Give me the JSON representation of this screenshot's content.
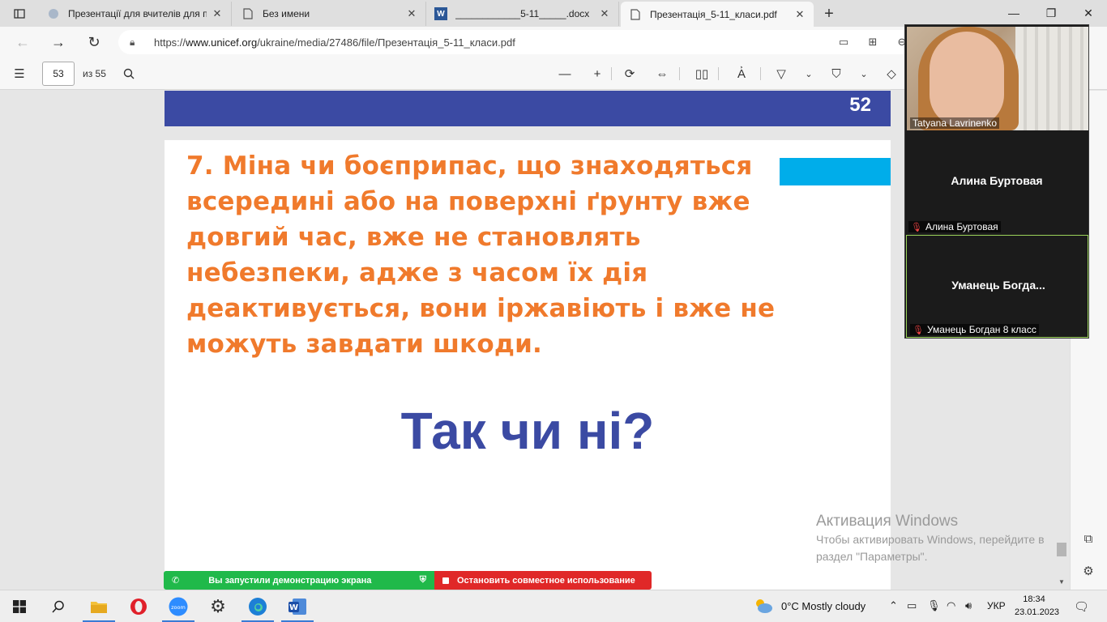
{
  "browser": {
    "tabs": [
      {
        "title": "Презентації для вчителів для про",
        "icon": "globe-icon",
        "active": false
      },
      {
        "title": "Без имени",
        "icon": "page-icon",
        "active": false
      },
      {
        "title": "____________5-11_____.docx",
        "icon": "word-icon",
        "active": false
      },
      {
        "title": "Презентація_5-11_класи.pdf",
        "icon": "page-icon",
        "active": true
      }
    ],
    "new_tab_label": "+",
    "url_scheme": "https://",
    "url_host": "www.unicef.org",
    "url_path": "/ukraine/media/27486/file/Презентація_5-11_класи.pdf"
  },
  "pdf_toolbar": {
    "current_page": "53",
    "total_label": "из 55"
  },
  "pdf": {
    "prev_page_number": "52",
    "statement": "7. Міна чи боєприпас, що знаходяться всередині або на поверхні ґрунту вже довгий час, вже не становлять небезпеки, адже з часом їх дія деактивується, вони іржавіють і вже не можуть завдати шкоди.",
    "question": "Так чи ні?"
  },
  "watermark": {
    "title": "Активация Windows",
    "text": "Чтобы активировать Windows, перейдите в раздел \"Параметры\"."
  },
  "share_bar": {
    "status": "Вы запустили демонстрацию экрана",
    "stop": "Остановить совместное использование"
  },
  "zoom": {
    "participants": [
      {
        "name": "Tatyana Lavrinenko"
      },
      {
        "name": "Алина Буртовая",
        "label": "Алина Буртовая"
      },
      {
        "name": "Уманець  Богда...",
        "label": "Уманець Богдан 8 класс"
      }
    ]
  },
  "taskbar": {
    "weather": "0°C  Mostly cloudy",
    "language": "УКР",
    "time": "18:34",
    "date": "23.01.2023"
  },
  "colors": {
    "slide_orange": "#f07a2c",
    "slide_blue": "#3b4aa3",
    "slide_cyan": "#00adea",
    "share_green": "#20b94a",
    "share_red": "#e02828"
  }
}
